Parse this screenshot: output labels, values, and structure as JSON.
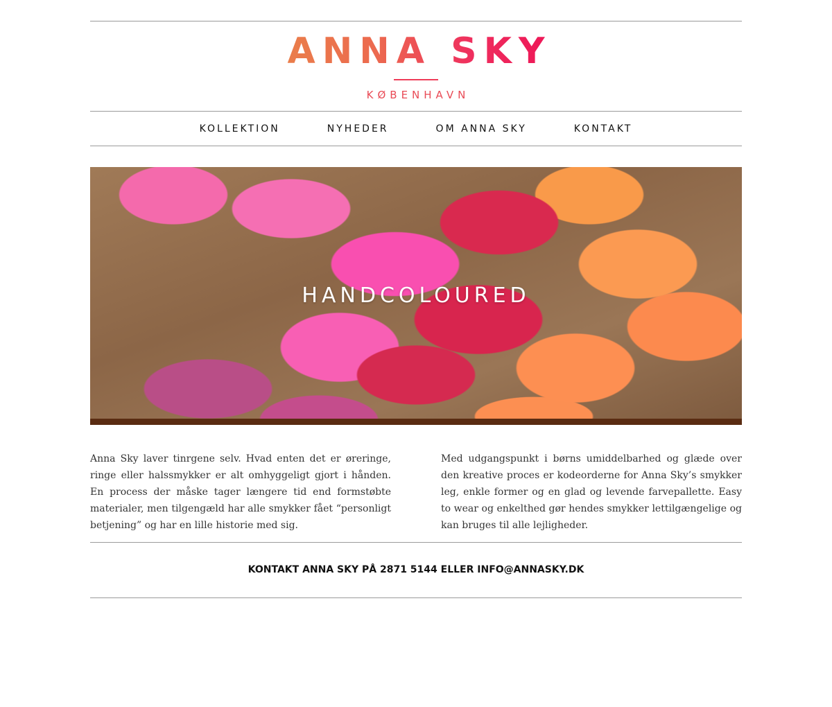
{
  "brand": {
    "title": "ANNA SKY",
    "subtitle": "KØBENHAVN"
  },
  "nav": {
    "items": [
      {
        "label": "KOLLEKTION"
      },
      {
        "label": "NYHEDER"
      },
      {
        "label": "OM ANNA SKY"
      },
      {
        "label": "KONTAKT"
      }
    ]
  },
  "hero": {
    "caption": "HANDCOLOURED"
  },
  "content": {
    "left_paragraph": "Anna Sky laver tinrgene selv. Hvad enten det er øreringe, ringe eller halssmykker er alt omhyggeligt gjort i hånden. En process der måske tager længere tid end formstøbte materialer, men tilgengæld har alle smykker fået “personligt betjening” og har en lille historie med sig.",
    "right_paragraph": "Med udgangspunkt i børns umiddelbarhed og glæde over den kreative proces er kodeorderne for Anna Sky’s smykker leg, enkle former og en glad og levende farvepallette. Easy to wear og enkelthed gør hendes smykker lettilgængelige og kan bruges til alle lejligheder."
  },
  "footer": {
    "contact_text": "KONTAKT ANNA SKY PÅ 2871 5144 ELLER INFO@ANNASKY.DK"
  },
  "colors": {
    "brand_orange": "#ea7f4a",
    "brand_pink": "#ee1657",
    "rule": "#9a9a9a",
    "hero_bar": "#5a2c12"
  }
}
